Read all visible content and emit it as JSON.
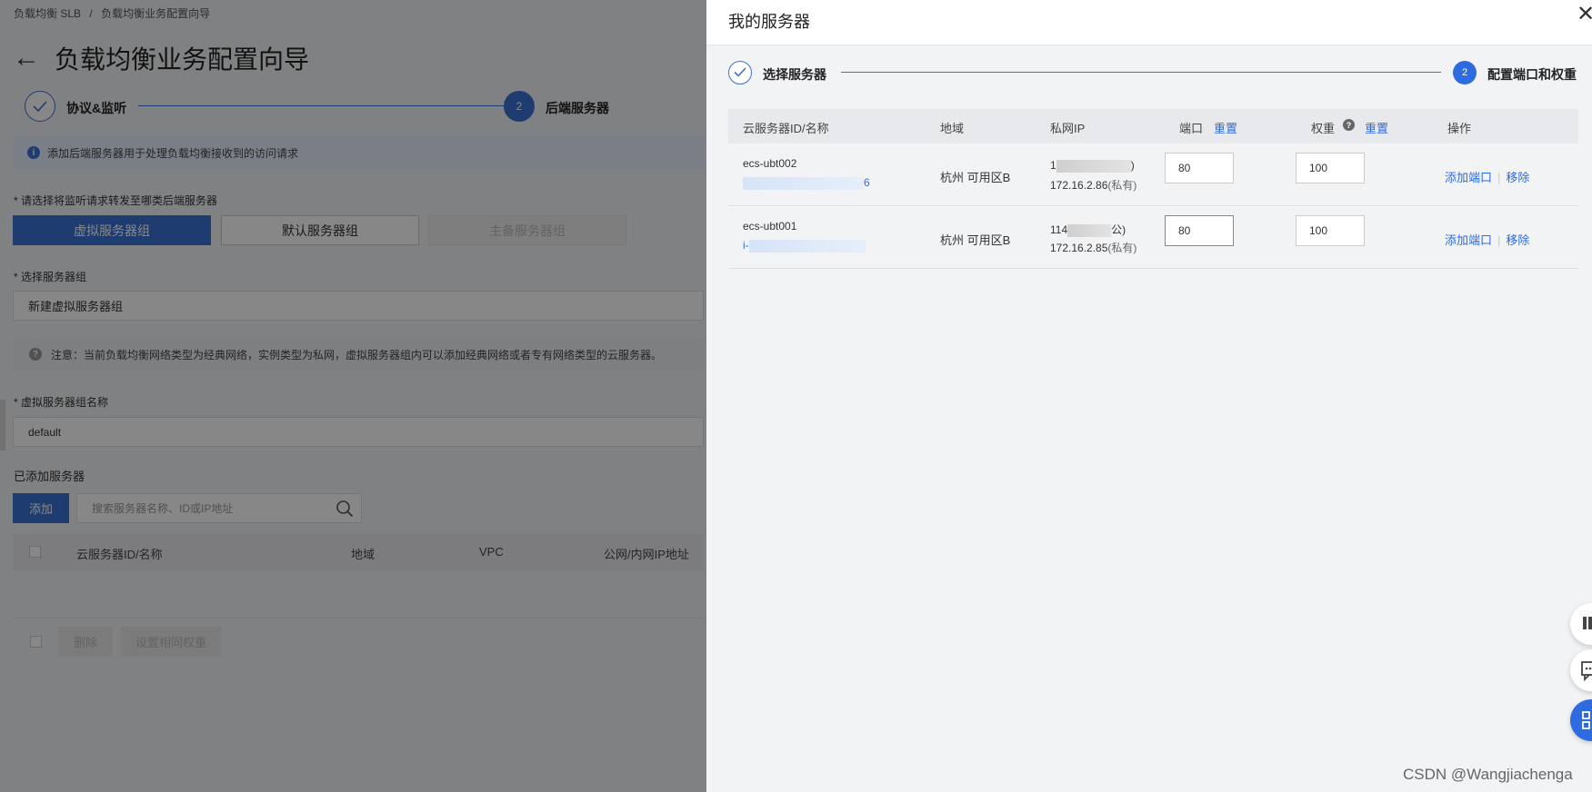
{
  "background": {
    "breadcrumb": [
      "负载均衡 SLB",
      "/",
      "负载均衡业务配置向导"
    ],
    "title": "负载均衡业务配置向导",
    "steps": [
      {
        "label": "协议&监听",
        "state": "done"
      },
      {
        "num": "2",
        "label": "后端服务器",
        "state": "active"
      }
    ],
    "info_text": "添加后端服务器用于处理负载均衡接收到的访问请求",
    "forward_label": "* 请选择将监听请求转发至哪类后端服务器",
    "group_tabs": [
      "虚拟服务器组",
      "默认服务器组",
      "主备服务器组"
    ],
    "select_group_label": "* 选择服务器组",
    "select_group_value": "新建虚拟服务器组",
    "note_text": "注意：当前负载均衡网络类型为经典网络，实例类型为私网，虚拟服务器组内可以添加经典网络或者专有网络类型的云服务器。",
    "group_name_label": "* 虚拟服务器组名称",
    "group_name_value": "default",
    "added_servers_label": "已添加服务器",
    "add_button": "添加",
    "search_placeholder": "搜索服务器名称、ID或IP地址",
    "table_headers": [
      "云服务器ID/名称",
      "地域",
      "VPC",
      "公网/内网IP地址"
    ],
    "footer_buttons": [
      "删除",
      "设置相同权重"
    ]
  },
  "drawer": {
    "title": "我的服务器",
    "close": "✕",
    "steps": [
      {
        "label": "选择服务器",
        "state": "done"
      },
      {
        "num": "2",
        "label": "配置端口和权重",
        "state": "active"
      }
    ],
    "headers": {
      "id_name": "云服务器ID/名称",
      "region": "地域",
      "private_ip": "私网IP",
      "port": "端口",
      "port_reset": "重置",
      "weight": "权重",
      "weight_help": "?",
      "weight_reset": "重置",
      "ops": "操作"
    },
    "rows": [
      {
        "name": "ecs-ubt002",
        "id_suffix": "6",
        "region": "杭州 可用区B",
        "ip_public_prefix": "1",
        "ip_public_suffix": ")",
        "ip_private": "172.16.2.86",
        "ip_private_tag": "(私有)",
        "port": "80",
        "weight": "100",
        "op_add": "添加端口",
        "op_sep": "|",
        "op_remove": "移除"
      },
      {
        "name": "ecs-ubt001",
        "id_prefix": "i-",
        "region": "杭州 可用区B",
        "ip_public_prefix": "114",
        "ip_public_suffix": "公)",
        "ip_private": "172.16.2.85",
        "ip_private_tag": "(私有)",
        "port": "80",
        "weight": "100",
        "op_add": "添加端口",
        "op_sep": "|",
        "op_remove": "移除"
      }
    ]
  },
  "float_buttons": [
    "app-icon",
    "feedback-icon",
    "grid-icon"
  ],
  "watermark": "CSDN @Wangjiachenga",
  "colors": {
    "primary": "#3b72d6",
    "link": "#2e6ae0",
    "overlay": "rgba(0,0,0,0.47)"
  }
}
